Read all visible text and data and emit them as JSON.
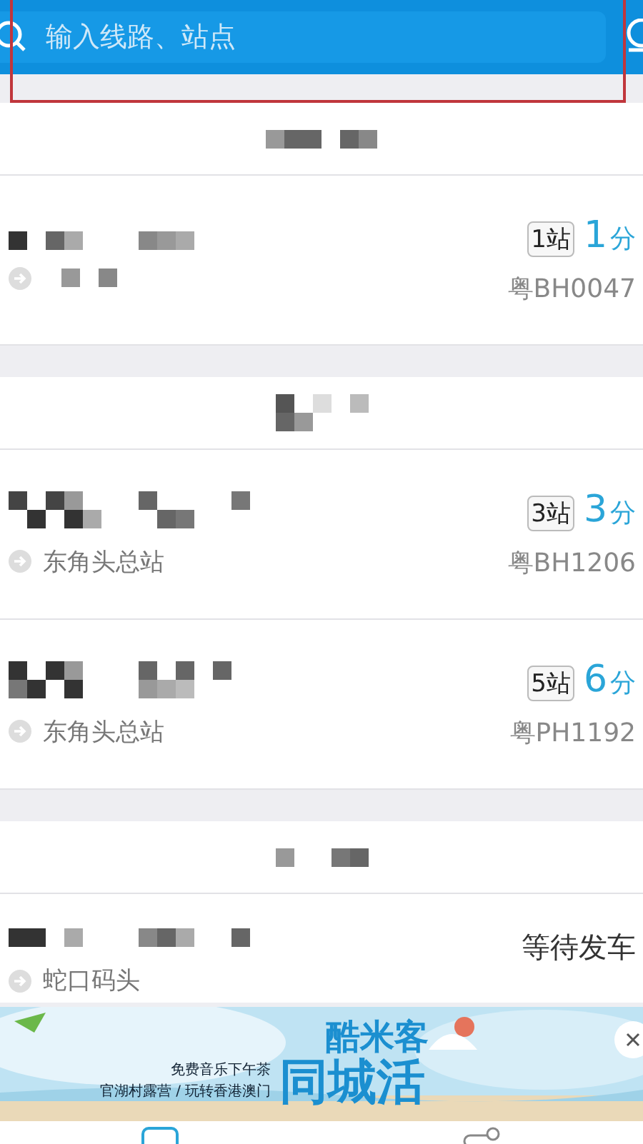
{
  "search": {
    "placeholder": "输入线路、站点"
  },
  "groups": [
    {
      "routes": [
        {
          "kind": "arriving",
          "stops": "1站",
          "minutes": "1",
          "unit": "分",
          "plate": "粤BH0047"
        }
      ]
    },
    {
      "routes": [
        {
          "kind": "arriving",
          "direction": "东角头总站",
          "stops": "3站",
          "minutes": "3",
          "unit": "分",
          "plate": "粤BH1206"
        },
        {
          "kind": "arriving",
          "direction": "东角头总站",
          "stops": "5站",
          "minutes": "6",
          "unit": "分",
          "plate": "粤PH1192"
        }
      ]
    },
    {
      "routes": [
        {
          "kind": "waiting",
          "direction": "蛇口码头",
          "status": "等待发车"
        }
      ]
    }
  ],
  "ad": {
    "brand": "酷米客",
    "line1": "免费音乐下午茶",
    "line2": "官湖村露营 / 玩转香港澳门",
    "headline": "同城活"
  }
}
